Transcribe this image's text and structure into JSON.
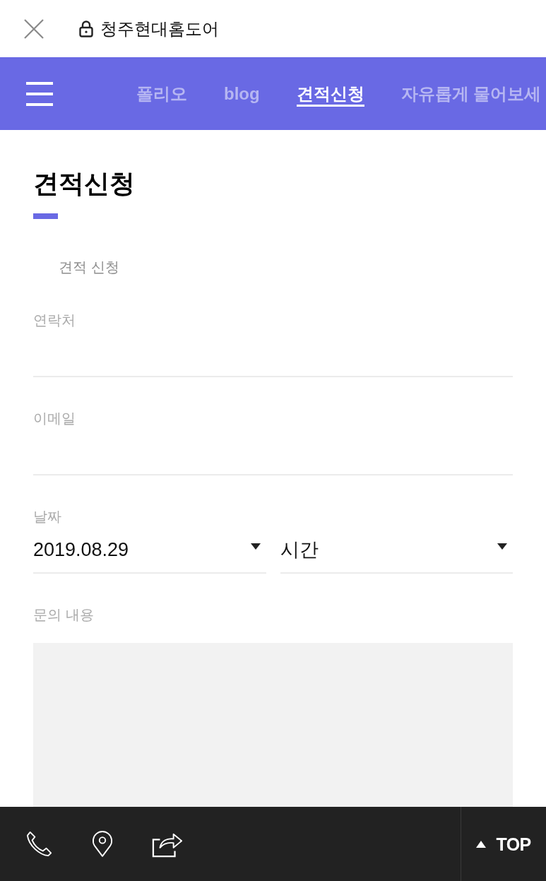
{
  "browser_bar": {
    "title": "청주현대홈도어"
  },
  "nav": {
    "items": [
      {
        "label": "폴리오",
        "selected": false
      },
      {
        "label": "blog",
        "selected": false
      },
      {
        "label": "견적신청",
        "selected": true
      },
      {
        "label": "자유롭게 물어보세",
        "selected": false
      }
    ]
  },
  "page": {
    "title": "견적신청",
    "subtitle": "견적 신청"
  },
  "form": {
    "fields": [
      {
        "kind": "text",
        "label": "연락처"
      },
      {
        "kind": "text",
        "label": "이메일"
      },
      {
        "kind": "selects",
        "label": "날짜",
        "selects": [
          {
            "value": "2019.08.29"
          },
          {
            "value": "시간"
          }
        ]
      },
      {
        "kind": "textarea",
        "label": "문의 내용"
      }
    ]
  },
  "bottom_bar": {
    "top_button": "TOP"
  }
}
